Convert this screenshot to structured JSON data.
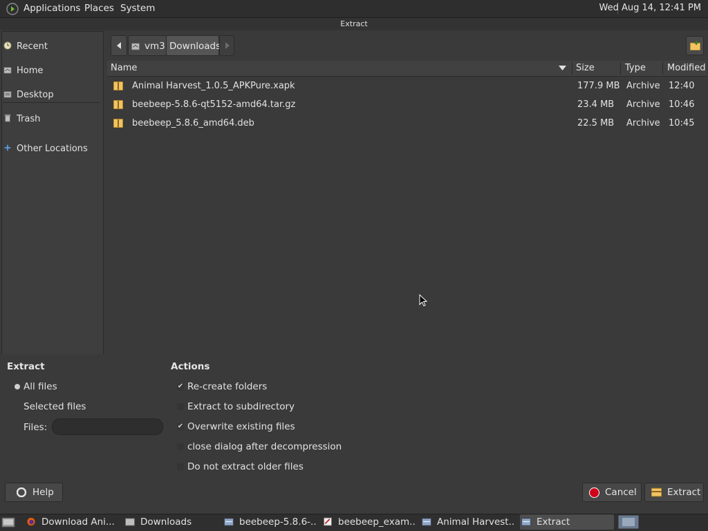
{
  "top_panel": {
    "menus": [
      "Applications",
      "Places",
      "System"
    ],
    "clock": "Wed Aug 14, 12:41 PM"
  },
  "window": {
    "title": "Extract"
  },
  "sidebar": {
    "items": [
      {
        "label": "Recent",
        "icon": "recent-icon"
      },
      {
        "label": "Home",
        "icon": "home-icon"
      },
      {
        "label": "Desktop",
        "icon": "desktop-icon"
      },
      {
        "label": "Trash",
        "icon": "trash-icon"
      },
      {
        "label": "Other Locations",
        "icon": "plus-icon"
      }
    ]
  },
  "pathbar": {
    "segments": [
      "vm3",
      "Downloads"
    ]
  },
  "file_list": {
    "columns": [
      "Name",
      "Size",
      "Type",
      "Modified"
    ],
    "rows": [
      {
        "name": "Animal Harvest_1.0.5_APKPure.xapk",
        "size": "177.9 MB",
        "type": "Archive",
        "modified": "12:40"
      },
      {
        "name": "beebeep-5.8.6-qt5152-amd64.tar.gz",
        "size": "23.4 MB",
        "type": "Archive",
        "modified": "10:46"
      },
      {
        "name": "beebeep_5.8.6_amd64.deb",
        "size": "22.5 MB",
        "type": "Archive",
        "modified": "10:45"
      }
    ]
  },
  "extract_options": {
    "title": "Extract",
    "all_files": "All files",
    "selected_files": "Selected files",
    "files_label": "Files:",
    "files_value": "",
    "selected": "All files"
  },
  "actions": {
    "title": "Actions",
    "recreate_folders": {
      "label": "Re-create folders",
      "checked": true
    },
    "extract_subdir": {
      "label": "Extract to subdirectory",
      "checked": false
    },
    "overwrite": {
      "label": "Overwrite existing files",
      "checked": true
    },
    "close_dialog": {
      "label": "close dialog after decompression",
      "checked": false
    },
    "no_older": {
      "label": "Do not extract older files",
      "checked": false
    }
  },
  "buttons": {
    "help": "Help",
    "cancel": "Cancel",
    "extract": "Extract"
  },
  "taskbar": {
    "items": [
      "Download Ani...",
      "Downloads",
      "beebeep-5.8.6-...",
      "beebeep_exam...",
      "Animal Harvest...",
      "Extract"
    ]
  },
  "colors": {
    "folder": "#f2c461",
    "cancel_red": "#d0021b"
  }
}
